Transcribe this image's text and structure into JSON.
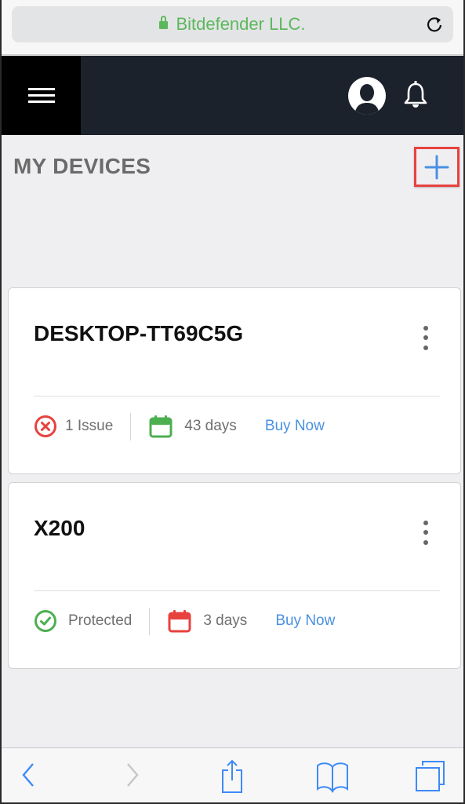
{
  "browser": {
    "url_label": "Bitdefender LLC.",
    "secure": true,
    "accent_color": "#5cb85c"
  },
  "header": {
    "menu_icon": "hamburger-icon",
    "avatar_icon": "user-avatar-icon",
    "notifications_icon": "bell-icon"
  },
  "page": {
    "title": "MY DEVICES",
    "add_icon": "plus-icon",
    "add_highlight_color": "#e8423f"
  },
  "devices": [
    {
      "name": "DESKTOP-TT69C5G",
      "status_icon": "error-circle-icon",
      "status_color": "#e8423f",
      "status": "1 Issue",
      "calendar_color": "#4caf50",
      "subscription": "43 days",
      "action": "Buy Now"
    },
    {
      "name": "X200",
      "status_icon": "check-circle-icon",
      "status_color": "#4caf50",
      "status": "Protected",
      "calendar_color": "#e8423f",
      "subscription": "3 days",
      "action": "Buy Now"
    }
  ],
  "toolbar": {
    "back_icon": "chevron-left-icon",
    "forward_icon": "chevron-right-icon",
    "share_icon": "share-icon",
    "bookmarks_icon": "book-icon",
    "tabs_icon": "tabs-icon",
    "link_color": "#4a90e2"
  }
}
